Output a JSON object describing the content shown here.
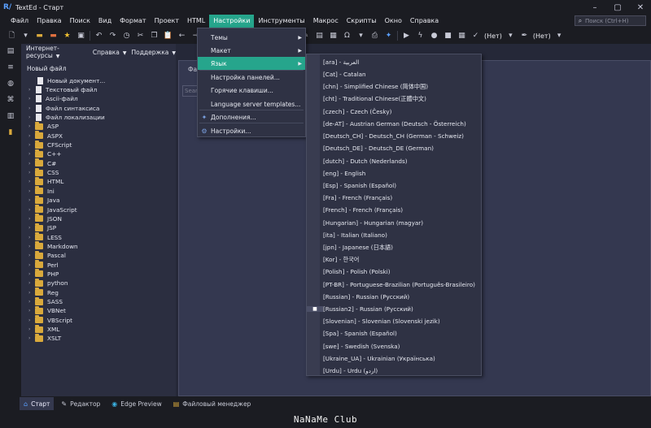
{
  "window": {
    "title": "TextEd - Старт",
    "logo": "R/"
  },
  "menubar": [
    "Файл",
    "Правка",
    "Поиск",
    "Вид",
    "Формат",
    "Проект",
    "HTML",
    "Настройки",
    "Инструменты",
    "Макрос",
    "Скрипты",
    "Окно",
    "Справка"
  ],
  "menubar_active_index": 7,
  "search": {
    "placeholder": "Поиск (Ctrl+H)"
  },
  "toolbar": {
    "lang_a": "(Нет)",
    "lang_b": "(Нет)"
  },
  "panel": {
    "tabs": [
      "Интернет-ресурсы",
      "Справка",
      "Поддержка"
    ],
    "header": "Новый файл",
    "docs": [
      "Новый документ...",
      "Текстовый файл",
      "Ascii-файл",
      "Файл синтаксиса",
      "Файл локализации"
    ],
    "folders": [
      "ASP",
      "ASPX",
      "CFScript",
      "C++",
      "C#",
      "CSS",
      "HTML",
      "Ini",
      "Java",
      "JavaScript",
      "JSON",
      "JSP",
      "LESS",
      "Markdown",
      "Pascal",
      "Perl",
      "PHP",
      "python",
      "Reg",
      "SASS",
      "VBNet",
      "VBScript",
      "XML",
      "XSLT"
    ]
  },
  "main": {
    "label": "Фай",
    "search_placeholder": "Search"
  },
  "settings_menu": {
    "items": [
      {
        "label": "Темы",
        "submenu": true
      },
      {
        "label": "Макет",
        "submenu": true
      },
      {
        "label": "Язык",
        "submenu": true,
        "highlighted": true
      },
      {
        "label": "Настройка панелей...",
        "submenu": false
      },
      {
        "label": "Горячие клавиши...",
        "submenu": false
      },
      {
        "label": "Language server templates...",
        "submenu": false
      },
      {
        "label": "Дополнения...",
        "submenu": false
      },
      {
        "label": "Настройки...",
        "submenu": false
      }
    ]
  },
  "language_menu": {
    "items": [
      "[ara] - العربية",
      "[Cat] - Catalan",
      "[chn] - Simplified Chinese (简体中国)",
      "[cht] - Traditional Chinese(正體中文)",
      "[czech] - Czech (Česky)",
      "[de-AT] - Austrian German (Deutsch - Österreich)",
      "[Deutsch_CH] - Deutsch_CH (German - Schweiz)",
      "[Deutsch_DE] - Deutsch_DE (German)",
      "[dutch] - Dutch (Nederlands)",
      "[eng] - English",
      "[Esp] - Spanish (Español)",
      "[Fra] - French (Français)",
      "[French] - French (Français)",
      "[Hungarian] - Hungarian (magyar)",
      "[ita] - Italian (Italiano)",
      "[jpn] - Japanese (日本語)",
      "[Kor] - 한국어",
      "[Polish] - Polish (Polski)",
      "[PT-BR] - Portuguese-Brazilian (Português-Brasileiro)",
      "[Russian] - Russian (Русский)",
      "[Russian2] - Russian (Русский)",
      "[Slovenian] - Slovenian (Slovenski jezik)",
      "[Spa] - Spanish (Español)",
      "[swe] - Swedish (Svenska)",
      "[Ukraine_UA] - Ukrainian (Українська)",
      "[Urdu] - Urdu (اردو)"
    ],
    "selected_index": 20
  },
  "bottom_tabs": [
    {
      "label": "Старт",
      "icon": "home-icon",
      "active": true
    },
    {
      "label": "Редактор",
      "icon": "pencil-icon",
      "active": false
    },
    {
      "label": "Edge Preview",
      "icon": "edge-icon",
      "active": false
    },
    {
      "label": "Файловый менеджер",
      "icon": "file-manager-icon",
      "active": false
    }
  ],
  "watermark": "NaNaMe Club",
  "colors": {
    "accent": "#26a58c",
    "folder": "#d9a93c",
    "panel": "#2b2e40",
    "menu": "#2f3244"
  }
}
